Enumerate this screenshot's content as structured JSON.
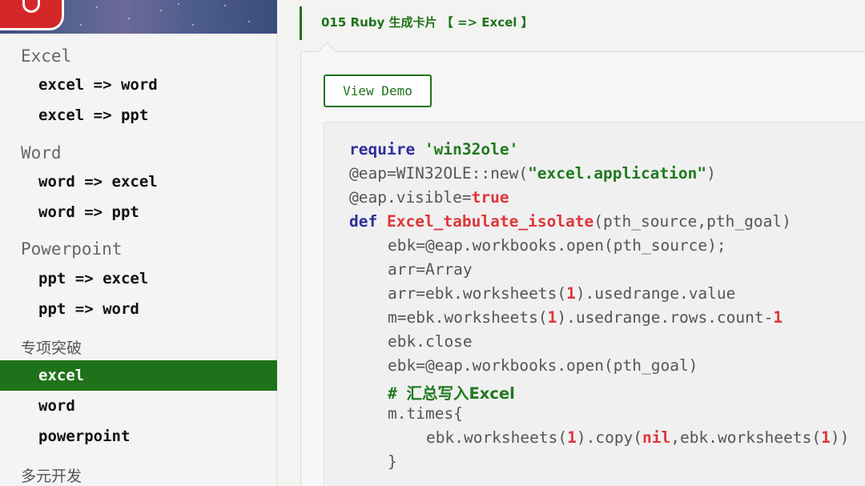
{
  "sidebar": {
    "sections": [
      {
        "title": "Excel",
        "items": [
          "excel => word",
          "excel => ppt"
        ]
      },
      {
        "title": "Word",
        "items": [
          "word => excel",
          "word => ppt"
        ]
      },
      {
        "title": "Powerpoint",
        "items": [
          "ppt => excel",
          "ppt => word"
        ]
      },
      {
        "title": "专项突破",
        "items": [
          "excel",
          "word",
          "powerpoint"
        ]
      },
      {
        "title": "多元开发",
        "items": []
      }
    ],
    "active_item": "excel"
  },
  "breadcrumb": "015 Ruby 生成卡片 【 => Excel 】",
  "demo_button": "View Demo",
  "code": {
    "l1_kw": "require",
    "l1_str": "'win32ole'",
    "l2_a": "@eap=WIN32OLE::new(",
    "l2_str": "\"excel.application\"",
    "l2_b": ")",
    "l3_a": "@eap.visible=",
    "l3_bool": "true",
    "l4_kw": "def",
    "l4_fn": "Excel_tabulate_isolate",
    "l4_b": "(pth_source,pth_goal)",
    "l5": "ebk=@eap.workbooks.open(pth_source);",
    "l6": "arr=Array",
    "l7_a": "arr=ebk.worksheets(",
    "l7_num": "1",
    "l7_b": ").usedrange.value",
    "l8_a": "m=ebk.worksheets(",
    "l8_num": "1",
    "l8_b": ").usedrange.rows.count-",
    "l8_num2": "1",
    "l9": "ebk.close",
    "l10": "ebk=@eap.workbooks.open(pth_goal)",
    "l11_hash": "# ",
    "l11_cmt": "汇总写入Excel",
    "l12": "m.times{",
    "l13_a": "ebk.worksheets(",
    "l13_num": "1",
    "l13_b": ").copy(",
    "l13_nil": "nil",
    "l13_c": ",ebk.worksheets(",
    "l13_num2": "1",
    "l13_d": "))",
    "l14": "}"
  },
  "colors": {
    "accent_green": "#1f721a",
    "code_keyword": "#2d2d9c",
    "code_string": "#1f7a1f",
    "code_literal": "#e0353a"
  }
}
